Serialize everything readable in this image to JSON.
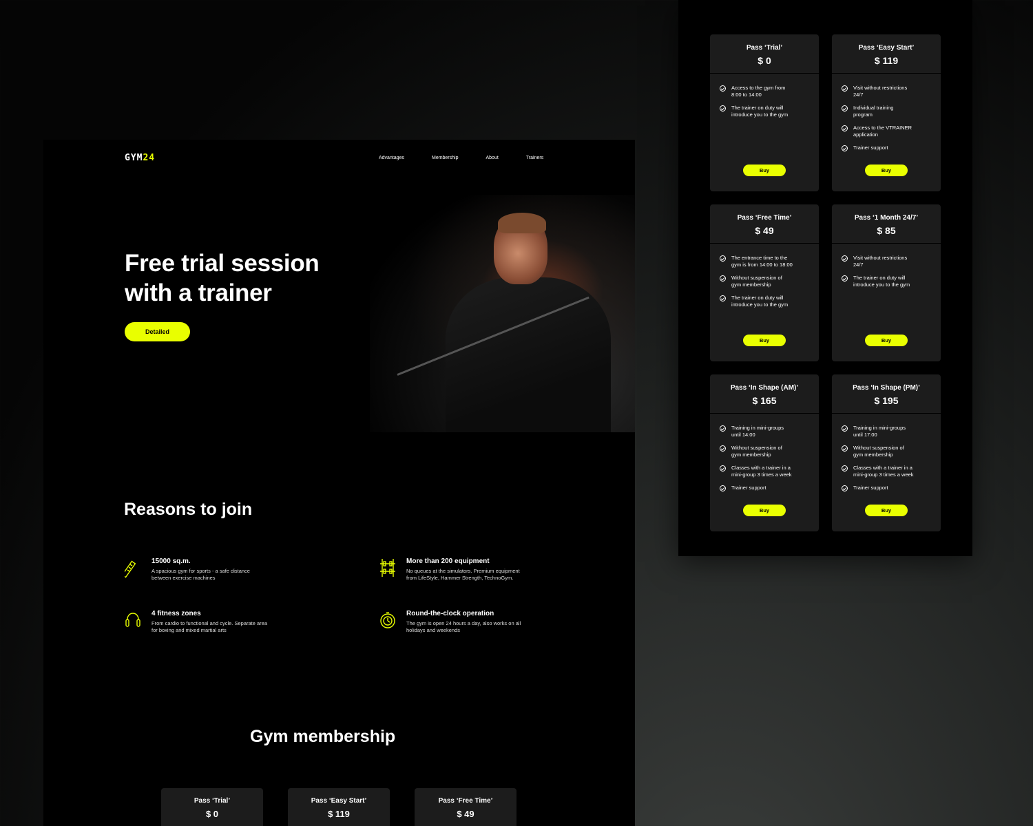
{
  "brand": {
    "logo_main": "GYM",
    "logo_accent": "24",
    "accent_color": "#e9ff00"
  },
  "nav": [
    "Advantages",
    "Membership",
    "About",
    "Trainers"
  ],
  "hero": {
    "title_line1": "Free trial session",
    "title_line2": "with a trainer",
    "button": "Detailed"
  },
  "reasons": {
    "title": "Reasons to join",
    "items": [
      {
        "icon": "tape-measure-icon",
        "title": "15000 sq.m.",
        "desc_line1": "A spacious gym for sports - a safe distance",
        "desc_line2": "between exercise machines"
      },
      {
        "icon": "barbell-rack-icon",
        "title": "More than 200 equipment",
        "desc_line1": "No queues at the simulators. Premium equipment",
        "desc_line2": "from LifeStyle, Hammer Strength, TechnoGym."
      },
      {
        "icon": "jump-rope-icon",
        "title": "4 fitness zones",
        "desc_line1": "From cardio to functional and cycle. Separate area",
        "desc_line2": "for boxing and mixed martial arts"
      },
      {
        "icon": "stopwatch-icon",
        "title": "Round-the-clock operation",
        "desc_line1": "The gym is open 24 hours a day, also works on all",
        "desc_line2": "holidays and weekends"
      }
    ]
  },
  "membership": {
    "title": "Gym membership",
    "preview_cards": [
      {
        "name": "Pass ‘Trial’",
        "price": "$ 0"
      },
      {
        "name": "Pass ‘Easy Start’",
        "price": "$ 119"
      },
      {
        "name": "Pass ‘Free Time’",
        "price": "$ 49"
      }
    ]
  },
  "pricing": {
    "buy_label": "Buy",
    "cards": [
      {
        "name": "Pass ‘Trial’",
        "price": "$ 0",
        "features": [
          [
            "Access to the gym from",
            "8:00 to 14:00"
          ],
          [
            "The trainer on duty will",
            "introduce you to the gym"
          ]
        ]
      },
      {
        "name": "Pass ‘Easy Start’",
        "price": "$ 119",
        "features": [
          [
            "Visit without restrictions",
            "24/7"
          ],
          [
            "Individual training",
            "program"
          ],
          [
            "Access to the VTRAINER",
            "application"
          ],
          [
            "Trainer support",
            ""
          ]
        ]
      },
      {
        "name": "Pass ‘Free Time’",
        "price": "$ 49",
        "features": [
          [
            "The entrance time to the",
            "gym is from 14:00 to 18:00"
          ],
          [
            "Without suspension of",
            "gym membership"
          ],
          [
            "The trainer on duty will",
            "introduce you to the gym"
          ]
        ]
      },
      {
        "name": "Pass ‘1 Month 24/7’",
        "price": "$ 85",
        "features": [
          [
            "Visit without restrictions",
            "24/7"
          ],
          [
            "The trainer on duty will",
            "introduce you to the gym"
          ]
        ]
      },
      {
        "name": "Pass ‘In Shape (AM)’",
        "price": "$ 165",
        "features": [
          [
            "Training in mini-groups",
            "until 14:00"
          ],
          [
            "Without suspension of",
            "gym membership"
          ],
          [
            "Classes with a trainer in a",
            "mini-group 3 times a week"
          ],
          [
            "Trainer support",
            ""
          ]
        ]
      },
      {
        "name": "Pass ‘In Shape (PM)’",
        "price": "$ 195",
        "features": [
          [
            "Training in mini-groups",
            "until 17:00"
          ],
          [
            "Without suspension of",
            "gym membership"
          ],
          [
            "Classes with a trainer in a",
            "mini-group 3 times a week"
          ],
          [
            "Trainer support",
            ""
          ]
        ]
      }
    ]
  }
}
